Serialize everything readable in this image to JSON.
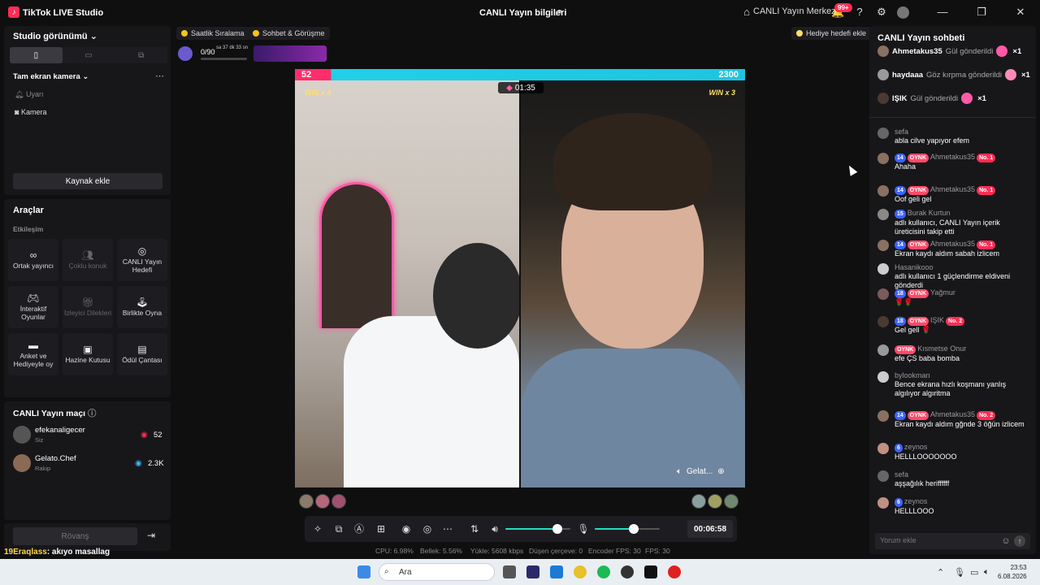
{
  "titlebar": {
    "app_title": "TikTok LIVE Studio",
    "center_title": "CANLI Yayın bilgileri",
    "center_link": "CANLI Yayın Merkezi",
    "notif_badge": "99+"
  },
  "left": {
    "studio_view_label": "Studio görünümü",
    "camera_section": "Tam ekran kamera",
    "source_items": [
      "Uyarı",
      "Kamera"
    ],
    "add_source": "Kaynak ekle",
    "tools_title": "Araçlar",
    "interaction_label": "Etkileşim",
    "tools": [
      {
        "label": "Ortak yayıncı",
        "icon": "link-icon"
      },
      {
        "label": "Çoklu konuk",
        "icon": "multi-guest-icon"
      },
      {
        "label": "CANLI Yayın Hedefi",
        "icon": "target-icon"
      },
      {
        "label": "İnteraktif Oyunlar",
        "icon": "gamepad-icon"
      },
      {
        "label": "İzleyici Dilekleri",
        "icon": "gift-icon"
      },
      {
        "label": "Birlikte Oyna",
        "icon": "joystick-icon"
      },
      {
        "label": "Anket ve Hediyeyle oy",
        "icon": "poll-icon"
      },
      {
        "label": "Hazine Kutusu",
        "icon": "treasure-icon"
      },
      {
        "label": "Ödül Çantası",
        "icon": "reward-bag-icon"
      }
    ],
    "match_title": "CANLI Yayın maçı",
    "match_players": [
      {
        "name": "efekanaligecer",
        "role": "Siz",
        "score": "52"
      },
      {
        "name": "Gelato.Chef",
        "role": "Rakip",
        "score": "2.3K"
      }
    ],
    "rematch": "Rövanş"
  },
  "top_tags": [
    "Saatlik Sıralama",
    "Sohbet & Görüşme"
  ],
  "gift_goal": "Hediye hedefi ekle",
  "mini_stat": {
    "value": "0/90",
    "sub": "sa 37 dk 33 sn"
  },
  "video": {
    "left_score": "52",
    "right_score": "2300",
    "left_win": "WIN x 4",
    "right_win": "WIN x 3",
    "timer": "01:35",
    "opponent_name": "Gelat..."
  },
  "controls": {
    "elapsed": "00:06:58",
    "volume": 0.8,
    "mic": 0.6
  },
  "stats": {
    "cpu": "CPU: 6.98%",
    "memory": "Bellek: 5.56%",
    "upload": "Yükle: 5608 kbps",
    "dropped": "Düşen çerçeve: 0",
    "encoder": "Encoder FPS: 30",
    "fps": "FPS: 30"
  },
  "chat": {
    "title": "CANLI Yayın sohbeti",
    "gifts": [
      {
        "user": "Ahmetakus35",
        "text": "Gül gönderildi",
        "count": "×1"
      },
      {
        "user": "haydaaa",
        "text": "Göz kırpma gönderildi",
        "count": "×1"
      },
      {
        "user": "IŞIK",
        "text": "Gül gönderildi",
        "count": "×1"
      }
    ],
    "messages": [
      {
        "name": "sefa",
        "text": "abla cilve yapıyor efem",
        "lvl": "",
        "fan": "",
        "no": ""
      },
      {
        "name": "Ahmetakus35",
        "text": "Ahaha",
        "lvl": "14",
        "fan": "OYNK",
        "no": "No. 1"
      },
      {
        "name": "Ahmetakus35",
        "text": "Oof geli gel",
        "lvl": "14",
        "fan": "OYNK",
        "no": "No. 1"
      },
      {
        "name": "Burak Kurtun",
        "text": "adlı kullanıcı, CANLI Yayın içerik üreticisini takip etti",
        "lvl": "15",
        "fan": "",
        "no": ""
      },
      {
        "name": "Ahmetakus35",
        "text": "Ekran kaydı aldım sabah izlicem",
        "lvl": "14",
        "fan": "OYNK",
        "no": "No. 1"
      },
      {
        "name": "Hasanikooo",
        "text": "adlı kullanıcı 1 güçlendirme eldiveni gönderdi",
        "lvl": "",
        "fan": "",
        "no": ""
      },
      {
        "name": "Yağmur",
        "text": "🌹🌹",
        "lvl": "18",
        "fan": "OYNK",
        "no": ""
      },
      {
        "name": "IŞIK",
        "text": "Gel gell 🌹",
        "lvl": "18",
        "fan": "OYNK",
        "no": "No. 2"
      },
      {
        "name": "Kısmetse Onur",
        "text": "efe ÇS baba bomba",
        "lvl": "",
        "fan": "OYNK",
        "no": ""
      },
      {
        "name": "bylookman",
        "text": "Bence ekrana hızlı koşmanı yanlış algılıyor algıritma",
        "lvl": "",
        "fan": "",
        "no": ""
      },
      {
        "name": "Ahmetakus35",
        "text": "Ekran kaydı aldım gğnde 3 öğün izlicem",
        "lvl": "14",
        "fan": "OYNK",
        "no": "No. 2"
      },
      {
        "name": "zeynos",
        "text": "HELLLOOOOOOO",
        "lvl": "6",
        "fan": "",
        "no": ""
      },
      {
        "name": "sefa",
        "text": "aşşağılık heriffffff",
        "lvl": "",
        "fan": "",
        "no": ""
      },
      {
        "name": "zeynos",
        "text": "HELLLOOO",
        "lvl": "6",
        "fan": "",
        "no": ""
      }
    ],
    "input_placeholder": "Yorum ekle"
  },
  "overlay": {
    "user": "19Eraqlass",
    "text": ": akıyo masallag"
  },
  "taskbar": {
    "search_placeholder": "Ara",
    "time": "23:53",
    "date": "6.08.2026"
  },
  "colors": {
    "accent": "#ff2d55",
    "teal": "#20d0e8",
    "pink": "#ff2d6a",
    "level": "#3d63ff"
  }
}
